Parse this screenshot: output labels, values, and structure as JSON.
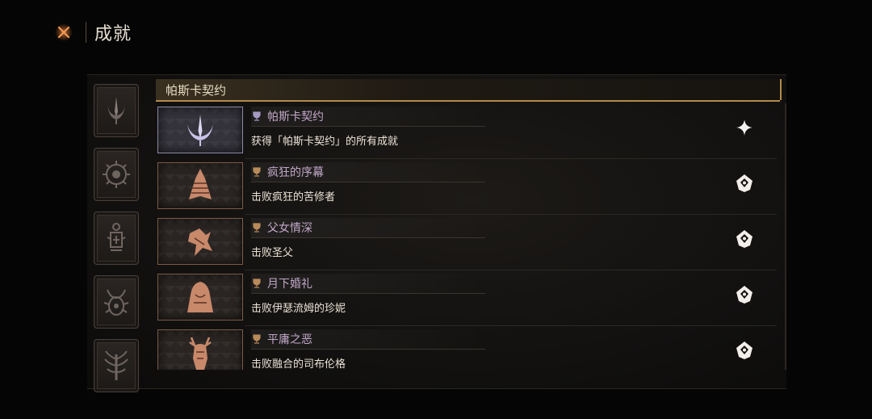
{
  "header": {
    "title": "成就",
    "close_icon": "close-x-icon",
    "accent": "#e07a3a"
  },
  "sidebar": {
    "tabs": [
      {
        "icon": "crescent-crown-icon",
        "selected": true
      },
      {
        "icon": "sun-sigil-icon"
      },
      {
        "icon": "lantern-sigil-icon"
      },
      {
        "icon": "horned-sigil-icon"
      },
      {
        "icon": "tree-sigil-icon"
      }
    ]
  },
  "section": {
    "title": "帕斯卡契约"
  },
  "achievements": [
    {
      "name": "帕斯卡契约",
      "desc": "获得「帕斯卡契约」的所有成就",
      "icon": "crescent-crown-icon",
      "status_icon": "sparkle-icon"
    },
    {
      "name": "疯狂的序幕",
      "desc": "击败疯狂的苦修者",
      "icon": "spiked-beast-icon",
      "status_icon": "emblem-icon"
    },
    {
      "name": "父女情深",
      "desc": "击败圣父",
      "icon": "twisted-figure-icon",
      "status_icon": "emblem-icon"
    },
    {
      "name": "月下婚礼",
      "desc": "击败伊瑟流姆的珍妮",
      "icon": "veiled-bride-icon",
      "status_icon": "emblem-icon"
    },
    {
      "name": "平庸之恶",
      "desc": "击败融合的司布伦格",
      "icon": "antler-beast-icon",
      "status_icon": "emblem-icon"
    }
  ]
}
